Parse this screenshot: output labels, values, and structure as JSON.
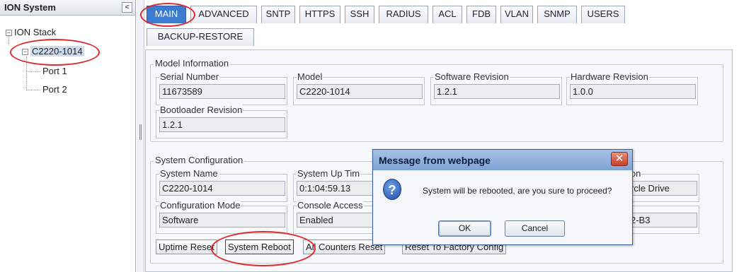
{
  "tree": {
    "title": "ION System",
    "collapse_glyph": "<",
    "nodes": [
      {
        "label": "ION Stack",
        "expander": "−"
      },
      {
        "label": "C2220-1014",
        "expander": "−"
      },
      {
        "label": "Port 1"
      },
      {
        "label": "Port 2"
      }
    ]
  },
  "tabs": {
    "row1": [
      "MAIN",
      "ADVANCED",
      "SNTP",
      "HTTPS",
      "SSH",
      "RADIUS",
      "ACL",
      "FDB",
      "VLAN",
      "SNMP",
      "USERS"
    ],
    "row2": [
      "BACKUP-RESTORE"
    ],
    "active": "MAIN"
  },
  "model_info": {
    "title": "Model Information",
    "fields": [
      {
        "label": "Serial Number",
        "value": "11673589"
      },
      {
        "label": "Model",
        "value": "C2220-1014"
      },
      {
        "label": "Software Revision",
        "value": "1.2.1"
      },
      {
        "label": "Hardware Revision",
        "value": "1.0.0"
      },
      {
        "label": "Bootloader Revision",
        "value": "1.2.1"
      }
    ]
  },
  "system_config": {
    "title": "System Configuration",
    "fields": [
      {
        "label": "System Name",
        "value": "C2220-1014"
      },
      {
        "label": "System Up Tim",
        "value": "0:1:04:59.13"
      },
      {
        "label": "ion",
        "value": "rcle Drive"
      },
      {
        "label": "Configuration Mode",
        "value": "Software"
      },
      {
        "label": "Console Access",
        "value": "Enabled"
      },
      {
        "label": "",
        "value": "2-B3"
      }
    ],
    "buttons": [
      "Uptime Reset",
      "System Reboot",
      "All Counters Reset",
      "Reset To Factory Config"
    ]
  },
  "dialog": {
    "title": "Message from webpage",
    "close_glyph": "✕",
    "icon_glyph": "?",
    "message": "System will be rebooted, are you sure to proceed?",
    "ok_label": "OK",
    "cancel_label": "Cancel"
  },
  "annotation_color": "#e0282a"
}
